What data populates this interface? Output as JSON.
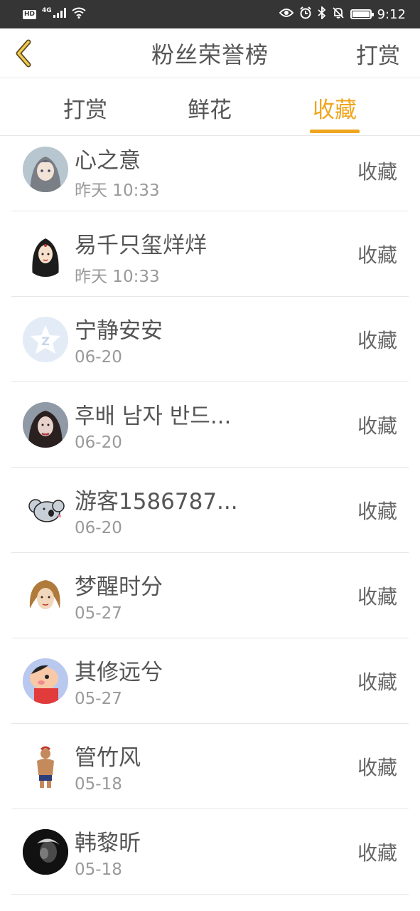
{
  "status_bar": {
    "hd": "HD",
    "network": "4G",
    "time": "9:12",
    "battery_level": 1.0
  },
  "header": {
    "back_icon": "chevron-left-icon",
    "title": "粉丝荣誉榜",
    "action_label": "打赏"
  },
  "tabs": [
    {
      "label": "打赏",
      "active": false
    },
    {
      "label": "鲜花",
      "active": false
    },
    {
      "label": "收藏",
      "active": true
    }
  ],
  "accent_color": "#f0a51e",
  "list": [
    {
      "name": "心之意",
      "date": "昨天 10:33",
      "action": "收藏",
      "avatar": "anime-girl-avatar"
    },
    {
      "name": "易千只玺烊烊",
      "date": "昨天 10:33",
      "action": "收藏",
      "avatar": "drawn-girl-avatar"
    },
    {
      "name": "宁静安安",
      "date": "06-20",
      "action": "收藏",
      "avatar": "default-q-avatar"
    },
    {
      "name": "후배 남자 반드...",
      "date": "06-20",
      "action": "收藏",
      "avatar": "photo-girl-avatar"
    },
    {
      "name": "游客1586787...",
      "date": "06-20",
      "action": "收藏",
      "avatar": "koala-avatar"
    },
    {
      "name": "梦醒时分",
      "date": "05-27",
      "action": "收藏",
      "avatar": "blonde-girl-avatar"
    },
    {
      "name": "其修远兮",
      "date": "05-27",
      "action": "收藏",
      "avatar": "cartoon-boy-avatar"
    },
    {
      "name": "管竹风",
      "date": "05-18",
      "action": "收藏",
      "avatar": "muscle-man-avatar"
    },
    {
      "name": "韩黎昕",
      "date": "05-18",
      "action": "收藏",
      "avatar": "dark-photo-avatar"
    }
  ]
}
